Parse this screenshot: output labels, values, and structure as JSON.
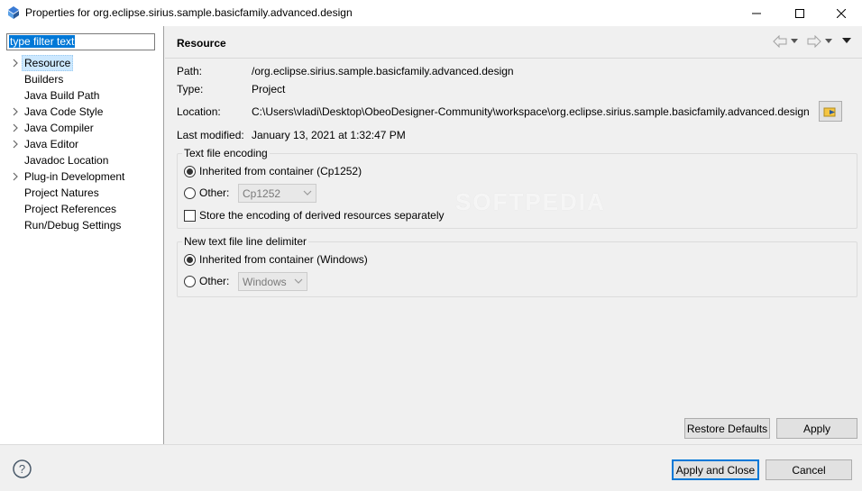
{
  "window": {
    "title": "Properties for org.eclipse.sirius.sample.basicfamily.advanced.design"
  },
  "filter": {
    "value": "type filter text"
  },
  "tree": {
    "items": [
      {
        "label": "Resource",
        "expandable": true,
        "selected": true
      },
      {
        "label": "Builders",
        "expandable": false
      },
      {
        "label": "Java Build Path",
        "expandable": false
      },
      {
        "label": "Java Code Style",
        "expandable": true
      },
      {
        "label": "Java Compiler",
        "expandable": true
      },
      {
        "label": "Java Editor",
        "expandable": true
      },
      {
        "label": "Javadoc Location",
        "expandable": false
      },
      {
        "label": "Plug-in Development",
        "expandable": true
      },
      {
        "label": "Project Natures",
        "expandable": false
      },
      {
        "label": "Project References",
        "expandable": false
      },
      {
        "label": "Run/Debug Settings",
        "expandable": false
      }
    ]
  },
  "page": {
    "title": "Resource",
    "path_label": "Path:",
    "path_value": "/org.eclipse.sirius.sample.basicfamily.advanced.design",
    "type_label": "Type:",
    "type_value": "Project",
    "location_label": "Location:",
    "location_value": "C:\\Users\\vladi\\Desktop\\ObeoDesigner-Community\\workspace\\org.eclipse.sirius.sample.basicfamily.advanced.design",
    "modified_label": "Last modified:",
    "modified_value": "January 13, 2021 at 1:32:47 PM"
  },
  "encoding": {
    "legend": "Text file encoding",
    "inherited_label": "Inherited from container (Cp1252)",
    "other_label": "Other:",
    "other_value": "Cp1252",
    "derived_label": "Store the encoding of derived resources separately"
  },
  "delimiter": {
    "legend": "New text file line delimiter",
    "inherited_label": "Inherited from container (Windows)",
    "other_label": "Other:",
    "other_value": "Windows"
  },
  "buttons": {
    "restore_defaults": "Restore Defaults",
    "apply": "Apply",
    "apply_close": "Apply and Close",
    "cancel": "Cancel"
  },
  "watermark": "SOFTPEDIA",
  "colors": {
    "selection": "#cce8ff",
    "accent": "#0078d7",
    "filter_highlight": "#0078d7"
  }
}
